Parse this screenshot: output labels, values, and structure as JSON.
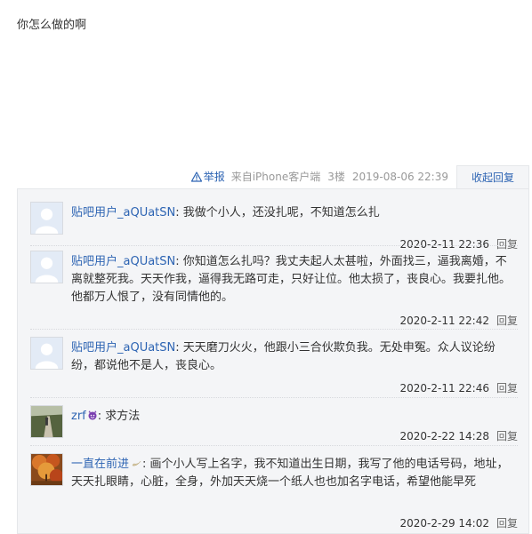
{
  "post": {
    "body": "你怎么做的啊",
    "report_label": "举报",
    "source": "来自iPhone客户端",
    "floor": "3楼",
    "time": "2019-08-06 22:39",
    "toggle_label": "收起回复"
  },
  "replies": [
    {
      "user": "贴吧用户_aQUatSN",
      "text": "我做个小人，还没扎呢，不知道怎么扎",
      "time": "2020-2-11 22:36",
      "reply_label": "回复",
      "avatar": "default-user-avatar"
    },
    {
      "user": "贴吧用户_aQUatSN",
      "text": "你知道怎么扎吗？我丈夫起人太甚啦，外面找三，逼我离婚，不离就整死我。天天作我，逼得我无路可走，只好让位。他太损了，丧良心。我要扎他。他都万人恨了，没有同情他的。",
      "time": "2020-2-11 22:42",
      "reply_label": "回复",
      "avatar": "default-user-avatar"
    },
    {
      "user": "贴吧用户_aQUatSN",
      "text": "天天磨刀火火，他跟小三合伙欺负我。无处申冤。众人议论纷纷，都说他不是人，丧良心。",
      "time": "2020-2-11 22:46",
      "reply_label": "回复",
      "avatar": "default-user-avatar"
    },
    {
      "user": "zrf",
      "text": "求方法",
      "time": "2020-2-22 14:28",
      "reply_label": "回复",
      "avatar": "photo-avatar-path"
    },
    {
      "user": "一直在前进",
      "text": "画个小人写上名字，我不知道出生日期，我写了他的电话号码，地址，天天扎眼睛，心脏，全身，外加天天烧一个纸人也也加名字电话，希望他能早死",
      "time": "2020-2-29 14:02",
      "reply_label": "回复",
      "avatar": "photo-avatar-autumn"
    }
  ],
  "colors": {
    "link": "#2d64b3",
    "panel_bg": "#f4f5f7",
    "panel_border": "#e5e7ea"
  }
}
